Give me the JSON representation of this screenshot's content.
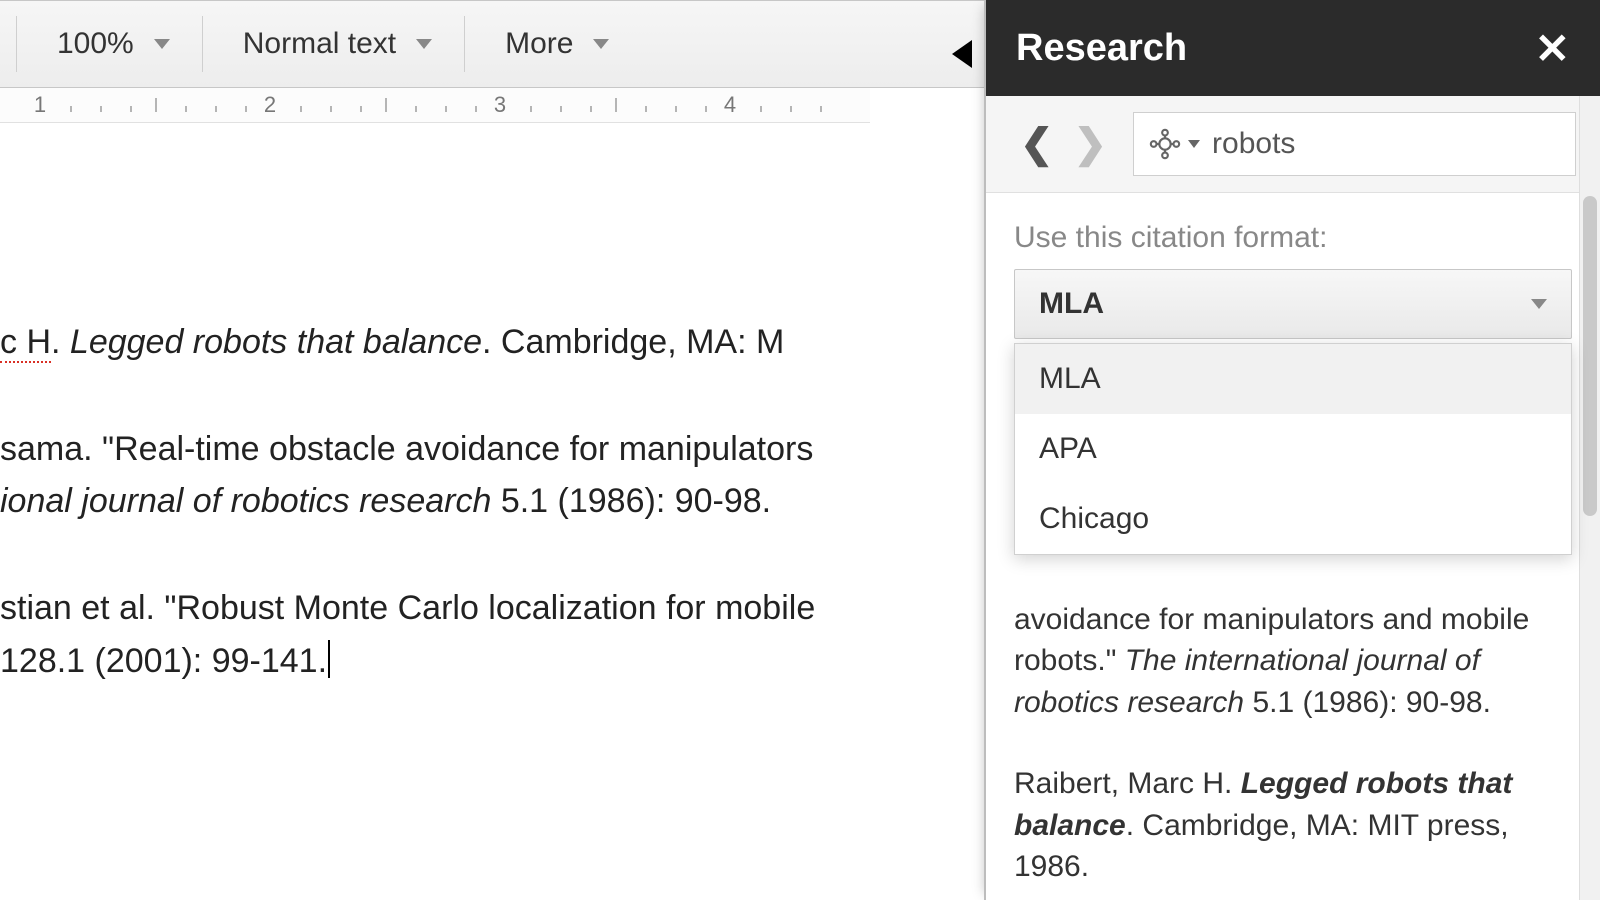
{
  "toolbar": {
    "zoom_label": "100%",
    "style_label": "Normal text",
    "more_label": "More"
  },
  "ruler": {
    "n1": "1",
    "n2": "2",
    "n3": "3",
    "n4": "4"
  },
  "doc": {
    "line1a": "c H",
    "line1b": ". ",
    "line1c_ital": "Legged robots that balance",
    "line1d": ". Cambridge, MA: M",
    "line2a": "sama. \"Real-time obstacle avoidance for manipulators",
    "line2b_ital": "ional journal of robotics research",
    "line2c": " 5.1 (1986): 90-98.",
    "line3a": "stian et al. \"Robust Monte Carlo localization for mobile",
    "line3b": " 128.1 (2001): 99-141."
  },
  "panel": {
    "title": "Research",
    "search_value": "robots",
    "citation_label": "Use this citation format:",
    "dropdown_selected": "MLA",
    "dropdown_options": {
      "o0": "MLA",
      "o1": "APA",
      "o2": "Chicago"
    },
    "result_partial": {
      "a": "avoidance for manipulators and mobile robots.\" ",
      "b_ital": "The international journal of robotics research",
      "c": " 5.1 (1986): 90-98."
    },
    "result2": {
      "a": "Raibert, Marc H. ",
      "b_bital": "Legged robots that balance",
      "c": ". Cambridge, MA: MIT press, 1986."
    }
  }
}
